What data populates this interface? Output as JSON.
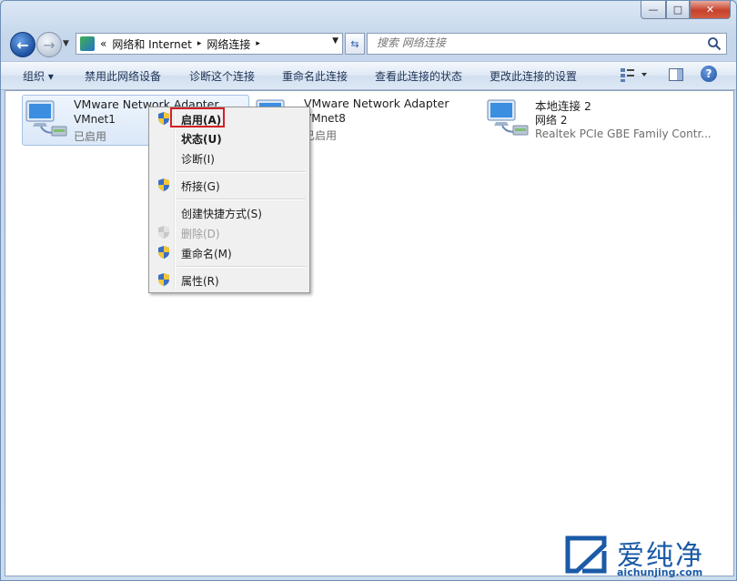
{
  "window": {
    "caption": {
      "minimize": "—",
      "maximize": "□",
      "close": "✕"
    }
  },
  "address": {
    "prefix": "«",
    "crumbs": [
      "网络和 Internet",
      "网络连接"
    ],
    "sep": "▸",
    "search_placeholder": "搜索 网络连接"
  },
  "toolbar": {
    "organize": "组织 ▾",
    "disable": "禁用此网络设备",
    "diagnose": "诊断这个连接",
    "rename": "重命名此连接",
    "view_status": "查看此连接的状态",
    "change_settings": "更改此连接的设置",
    "help": "?"
  },
  "adapters": [
    {
      "name": "VMware Network Adapter",
      "sub": "VMnet1",
      "status": "已启用"
    },
    {
      "name": "VMware Network Adapter",
      "sub": "VMnet8",
      "status": "已启用"
    },
    {
      "name": "本地连接 2",
      "sub": "网络 2",
      "status": "Realtek PCIe GBE Family Contr..."
    }
  ],
  "menu": {
    "enable": "启用(A)",
    "status": "状态(U)",
    "diagnose": "诊断(I)",
    "bridge": "桥接(G)",
    "shortcut": "创建快捷方式(S)",
    "delete": "删除(D)",
    "rename": "重命名(M)",
    "properties": "属性(R)"
  },
  "watermark": {
    "text": "爱纯净",
    "url": "aichunjing.com"
  },
  "colors": {
    "highlight_box": "#d32027",
    "accent": "#1a5aa6"
  }
}
